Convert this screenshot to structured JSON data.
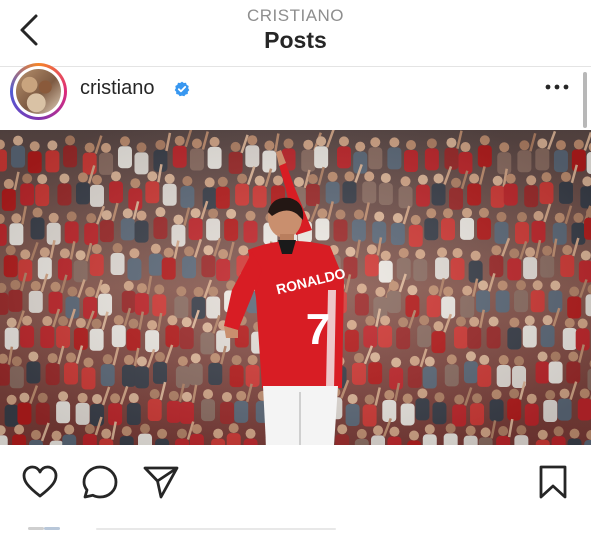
{
  "header": {
    "subtitle": "CRISTIANO",
    "title": "Posts",
    "back_icon": "chevron-left-icon"
  },
  "post": {
    "username": "cristiano",
    "verified": true,
    "verified_color": "#3897f0",
    "more_icon": "ellipsis-horizontal-icon",
    "jersey_text": "RONALDO",
    "jersey_number": "7"
  },
  "actions": {
    "like_icon": "heart-icon",
    "comment_icon": "comment-icon",
    "share_icon": "paper-plane-icon",
    "save_icon": "bookmark-icon"
  },
  "colors": {
    "text": "#262626",
    "muted": "#8e8e8e",
    "jersey_red": "#d81d24",
    "divider": "#e4e4e4"
  }
}
